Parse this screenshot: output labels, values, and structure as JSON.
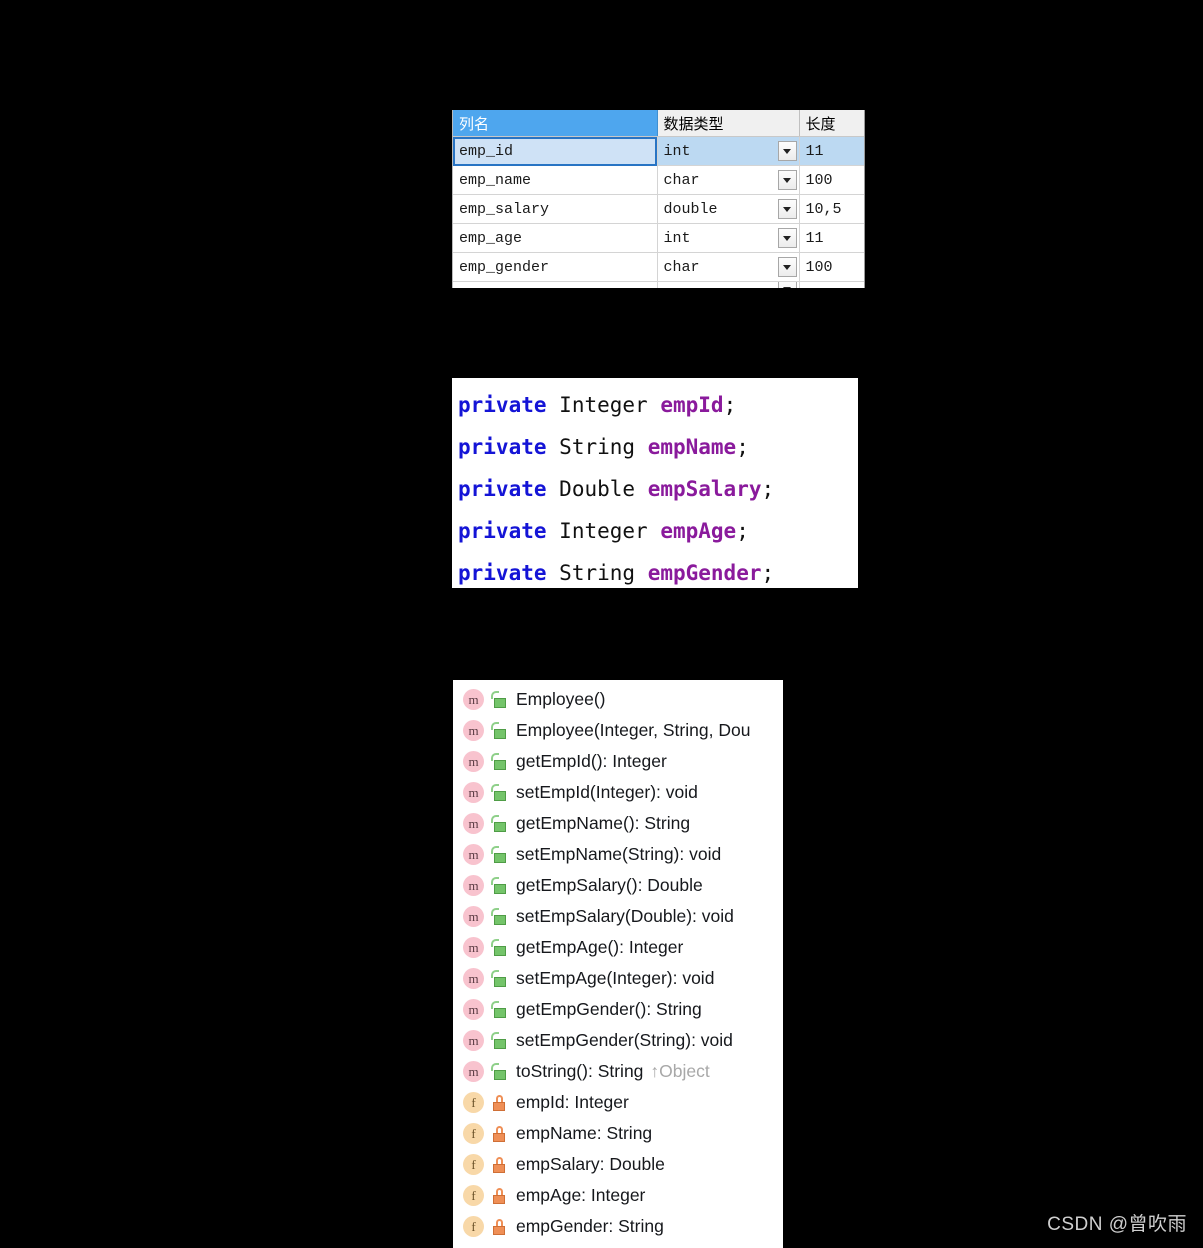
{
  "db_table": {
    "name": "column-designer-grid",
    "columns": [
      {
        "key": "name",
        "label": "列名"
      },
      {
        "key": "type",
        "label": "数据类型"
      },
      {
        "key": "length",
        "label": "长度"
      }
    ],
    "selected_header": "列名",
    "dropdown_icon": "chevron-down-icon",
    "rows": [
      {
        "name": "emp_id",
        "type": "int",
        "length": "11",
        "selected": true
      },
      {
        "name": "emp_name",
        "type": "char",
        "length": "100",
        "selected": false
      },
      {
        "name": "emp_salary",
        "type": "double",
        "length": "10,5",
        "selected": false
      },
      {
        "name": "emp_age",
        "type": "int",
        "length": "11",
        "selected": false
      },
      {
        "name": "emp_gender",
        "type": "char",
        "length": "100",
        "selected": false
      }
    ]
  },
  "code_panel": {
    "name": "java-field-declarations",
    "lines": [
      {
        "keyword": "private",
        "type": "Integer",
        "field": "empId",
        "terminator": ";"
      },
      {
        "keyword": "private",
        "type": "String",
        "field": "empName",
        "terminator": ";"
      },
      {
        "keyword": "private",
        "type": "Double",
        "field": "empSalary",
        "terminator": ";"
      },
      {
        "keyword": "private",
        "type": "Integer",
        "field": "empAge",
        "terminator": ";"
      },
      {
        "keyword": "private",
        "type": "String",
        "field": "empGender",
        "terminator": ";"
      }
    ],
    "colors": {
      "keyword": "#1414d6",
      "type": "#111111",
      "field": "#8a1a9c"
    }
  },
  "outline_panel": {
    "name": "class-outline-view",
    "items": [
      {
        "kind": "m",
        "kind_icon": "method-icon",
        "visibility_icon": "lock-open-icon",
        "visibility": "public",
        "label": "Employee()",
        "override": ""
      },
      {
        "kind": "m",
        "kind_icon": "method-icon",
        "visibility_icon": "lock-open-icon",
        "visibility": "public",
        "label": "Employee(Integer, String, Dou",
        "override": ""
      },
      {
        "kind": "m",
        "kind_icon": "method-icon",
        "visibility_icon": "lock-open-icon",
        "visibility": "public",
        "label": "getEmpId(): Integer",
        "override": ""
      },
      {
        "kind": "m",
        "kind_icon": "method-icon",
        "visibility_icon": "lock-open-icon",
        "visibility": "public",
        "label": "setEmpId(Integer): void",
        "override": ""
      },
      {
        "kind": "m",
        "kind_icon": "method-icon",
        "visibility_icon": "lock-open-icon",
        "visibility": "public",
        "label": "getEmpName(): String",
        "override": ""
      },
      {
        "kind": "m",
        "kind_icon": "method-icon",
        "visibility_icon": "lock-open-icon",
        "visibility": "public",
        "label": "setEmpName(String): void",
        "override": ""
      },
      {
        "kind": "m",
        "kind_icon": "method-icon",
        "visibility_icon": "lock-open-icon",
        "visibility": "public",
        "label": "getEmpSalary(): Double",
        "override": ""
      },
      {
        "kind": "m",
        "kind_icon": "method-icon",
        "visibility_icon": "lock-open-icon",
        "visibility": "public",
        "label": "setEmpSalary(Double): void",
        "override": ""
      },
      {
        "kind": "m",
        "kind_icon": "method-icon",
        "visibility_icon": "lock-open-icon",
        "visibility": "public",
        "label": "getEmpAge(): Integer",
        "override": ""
      },
      {
        "kind": "m",
        "kind_icon": "method-icon",
        "visibility_icon": "lock-open-icon",
        "visibility": "public",
        "label": "setEmpAge(Integer): void",
        "override": ""
      },
      {
        "kind": "m",
        "kind_icon": "method-icon",
        "visibility_icon": "lock-open-icon",
        "visibility": "public",
        "label": "getEmpGender(): String",
        "override": ""
      },
      {
        "kind": "m",
        "kind_icon": "method-icon",
        "visibility_icon": "lock-open-icon",
        "visibility": "public",
        "label": "setEmpGender(String): void",
        "override": ""
      },
      {
        "kind": "m",
        "kind_icon": "method-icon",
        "visibility_icon": "lock-open-icon",
        "visibility": "public",
        "label": "toString(): String",
        "override": "↑Object"
      },
      {
        "kind": "f",
        "kind_icon": "field-icon",
        "visibility_icon": "lock-closed-icon",
        "visibility": "private",
        "label": "empId: Integer",
        "override": ""
      },
      {
        "kind": "f",
        "kind_icon": "field-icon",
        "visibility_icon": "lock-closed-icon",
        "visibility": "private",
        "label": "empName: String",
        "override": ""
      },
      {
        "kind": "f",
        "kind_icon": "field-icon",
        "visibility_icon": "lock-closed-icon",
        "visibility": "private",
        "label": "empSalary: Double",
        "override": ""
      },
      {
        "kind": "f",
        "kind_icon": "field-icon",
        "visibility_icon": "lock-closed-icon",
        "visibility": "private",
        "label": "empAge: Integer",
        "override": ""
      },
      {
        "kind": "f",
        "kind_icon": "field-icon",
        "visibility_icon": "lock-closed-icon",
        "visibility": "private",
        "label": "empGender: String",
        "override": ""
      }
    ]
  },
  "watermark": {
    "text": "CSDN @曾吹雨"
  }
}
